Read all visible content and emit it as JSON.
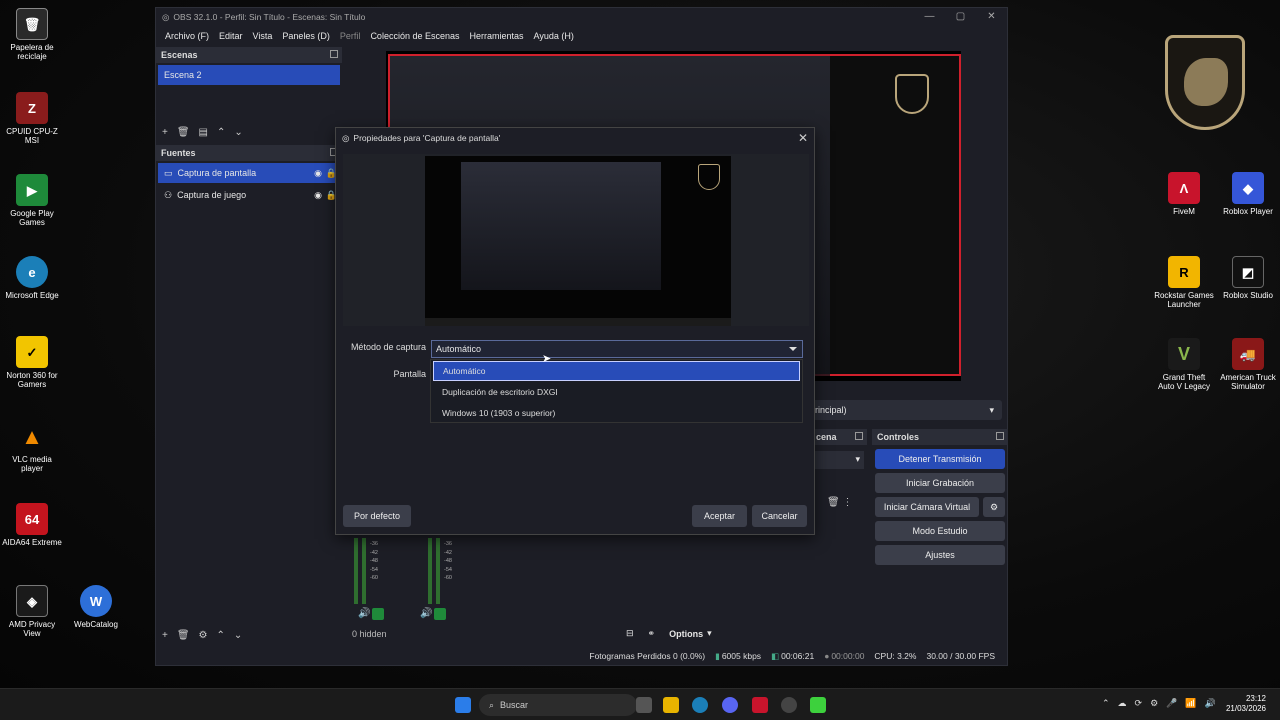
{
  "desktop": {
    "icons": [
      {
        "label": "Papelera de reciclaje",
        "name": "recycle-bin-icon"
      },
      {
        "label": "CPUID CPU-Z MSI",
        "name": "cpuz-icon"
      },
      {
        "label": "Google Play Games",
        "name": "google-play-games-icon"
      },
      {
        "label": "Microsoft Edge",
        "name": "edge-icon"
      },
      {
        "label": "Norton 360 for Gamers",
        "name": "norton-icon"
      },
      {
        "label": "VLC media player",
        "name": "vlc-icon"
      },
      {
        "label": "AIDA64 Extreme",
        "name": "aida64-icon"
      },
      {
        "label": "AMD Privacy View",
        "name": "amd-privacy-icon"
      },
      {
        "label": "WebCatalog",
        "name": "webcatalog-icon"
      },
      {
        "label": "FiveM",
        "name": "fivem-icon"
      },
      {
        "label": "Roblox Player",
        "name": "roblox-player-icon"
      },
      {
        "label": "Rockstar Games Launcher",
        "name": "rockstar-icon"
      },
      {
        "label": "Roblox Studio",
        "name": "roblox-studio-icon"
      },
      {
        "label": "Grand Theft Auto V Legacy",
        "name": "gta-icon"
      },
      {
        "label": "American Truck Simulator",
        "name": "ats-icon"
      }
    ]
  },
  "obs": {
    "title": "OBS 32.1.0 - Perfil: Sin Título - Escenas: Sin Título",
    "menu": [
      "Archivo (F)",
      "Editar",
      "Vista",
      "Paneles (D)",
      "Perfil",
      "Colección de Escenas",
      "Herramientas",
      "Ayuda (H)"
    ],
    "scenes_title": "Escenas",
    "scenes": [
      "Escena 2"
    ],
    "sources_title": "Fuentes",
    "sources": [
      "Captura de pantalla",
      "Captura de juego"
    ],
    "transition_partial": "rincipal)",
    "scene_transition_partial": "cena",
    "controls_title": "Controles",
    "controls": [
      "Detener Transmisión",
      "Iniciar Grabación",
      "Iniciar Cámara Virtual",
      "Modo Estudio",
      "Ajustes"
    ],
    "mixer_hidden": "0 hidden",
    "options": "Options",
    "status": {
      "dropped": "Fotogramas Perdidos 0 (0.0%)",
      "bitrate": "6005 kbps",
      "stream_time": "00:06:21",
      "rec_time": "00:00:00",
      "cpu": "CPU: 3.2%",
      "fps": "30.00 / 30.00 FPS"
    },
    "mixer_scale": [
      "-36",
      "-42",
      "-48",
      "-54",
      "-60"
    ]
  },
  "dialog": {
    "title": "Propiedades para 'Captura de pantalla'",
    "method_label": "Método de captura",
    "method_value": "Automático",
    "screen_label": "Pantalla",
    "options": [
      "Automático",
      "Duplicación de escritorio DXGI",
      "Windows 10 (1903 o superior)"
    ],
    "defaults_button": "Por defecto",
    "ok_button": "Aceptar",
    "cancel_button": "Cancelar"
  },
  "taskbar": {
    "search_placeholder": "Buscar",
    "time": "23:12",
    "date": "21/03/2026"
  }
}
